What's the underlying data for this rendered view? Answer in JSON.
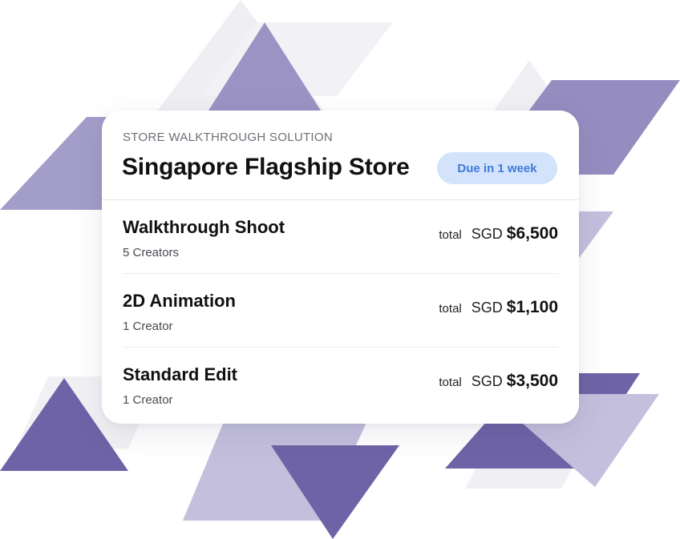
{
  "card": {
    "eyebrow": "STORE WALKTHROUGH SOLUTION",
    "title": "Singapore Flagship Store",
    "due_badge": "Due in 1 week"
  },
  "line_items": [
    {
      "name": "Walkthrough Shoot",
      "creators": "5 Creators",
      "total_label": "total",
      "currency": "SGD",
      "amount": "$6,500"
    },
    {
      "name": "2D Animation",
      "creators": "1 Creator",
      "total_label": "total",
      "currency": "SGD",
      "amount": "$1,100"
    },
    {
      "name": "Standard Edit",
      "creators": "1 Creator",
      "total_label": "total",
      "currency": "SGD",
      "amount": "$3,500"
    }
  ],
  "colors": {
    "triangle_dark": "#6d63a6",
    "triangle_mid": "#9b93c4",
    "triangle_light": "#c3bfdd",
    "triangle_faint": "#eeeef3",
    "badge_bg": "#d3e3fb",
    "badge_text": "#3e7ad8"
  }
}
